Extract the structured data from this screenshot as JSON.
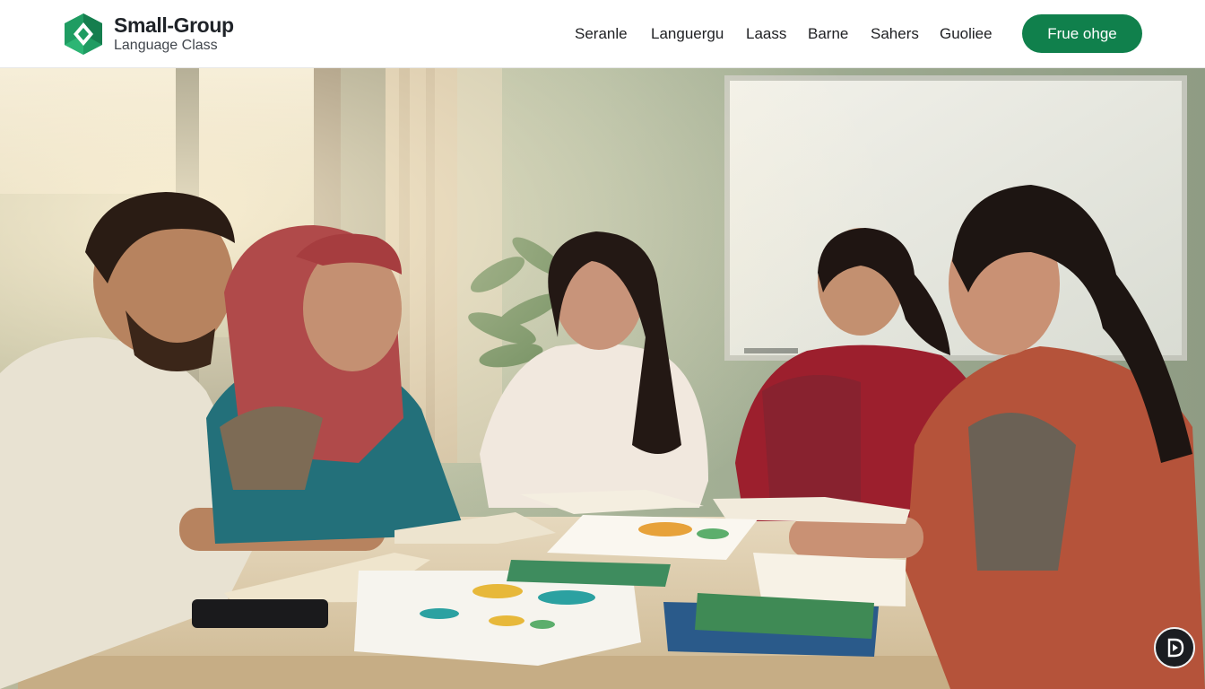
{
  "brand": {
    "title": "Small-Group",
    "subtitle": "Language Class",
    "logo_icon": "diamond-logo-icon",
    "brand_color": "#10804c"
  },
  "nav": {
    "items": [
      {
        "label": "Seranle"
      },
      {
        "label": "Languergu"
      },
      {
        "label": "Laass"
      },
      {
        "label": "Barne"
      },
      {
        "label": "Sahers"
      },
      {
        "label": "Guoliee"
      }
    ],
    "cta_label": "Frue ohge"
  },
  "hero": {
    "image": "small-group-language-class-photo",
    "media_icon": "play-icon"
  }
}
